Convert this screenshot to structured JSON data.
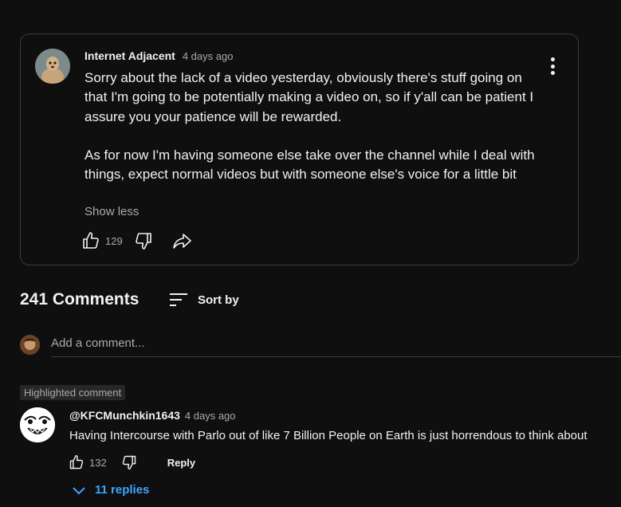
{
  "post": {
    "author": "Internet Adjacent",
    "time": "4 days ago",
    "paragraphs": [
      "Sorry about the lack of a video yesterday, obviously there's stuff going on that I'm going to be potentially making a video on, so if y'all can be patient I assure you your patience will be rewarded.",
      "As for now I'm having someone else take over the channel while I deal with things, expect normal videos but with someone else's voice for a little bit"
    ],
    "show_less": "Show less",
    "like_count": "129",
    "icons": [
      "avatar",
      "more-vert-icon",
      "like-icon",
      "dislike-icon",
      "share-icon"
    ]
  },
  "comments": {
    "count_label": "241 Comments",
    "sort_label": "Sort by",
    "add_placeholder": "Add a comment..."
  },
  "highlighted": {
    "badge": "Highlighted comment",
    "author": "@KFCMunchkin1643",
    "time": "4 days ago",
    "text": "Having Intercourse with Parlo out of like 7 Billion People on Earth is just horrendous to think about",
    "like_count": "132",
    "reply_label": "Reply",
    "replies_label": "11 replies"
  },
  "colors": {
    "background": "#0f0f0f",
    "text": "#f1f1f1",
    "muted": "#aaaaaa",
    "link": "#3ea6ff",
    "border": "#3a3a3a"
  }
}
